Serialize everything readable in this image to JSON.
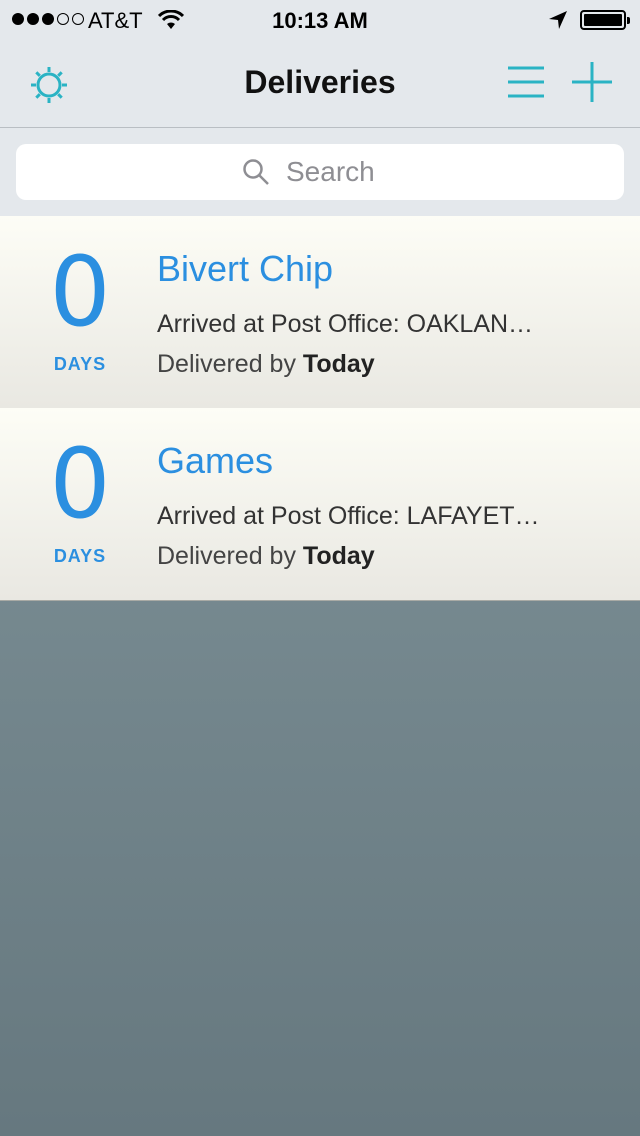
{
  "status_bar": {
    "carrier": "AT&T",
    "time": "10:13 AM",
    "signal_bars_filled": 3,
    "signal_bars_total": 5
  },
  "nav": {
    "title": "Deliveries",
    "settings_icon": "gear-icon",
    "list_icon": "menu-icon",
    "add_icon": "plus-icon"
  },
  "search": {
    "placeholder": "Search"
  },
  "deliveries": [
    {
      "days": "0",
      "days_label": "DAYS",
      "name": "Bivert Chip",
      "status": "Arrived at Post Office: OAKLAN…",
      "delivered_prefix": "Delivered by",
      "delivered_when": "Today"
    },
    {
      "days": "0",
      "days_label": "DAYS",
      "name": "Games",
      "status": "Arrived at Post Office: LAFAYET…",
      "delivered_prefix": "Delivered by",
      "delivered_when": "Today"
    }
  ],
  "colors": {
    "accent_teal": "#2ab3c4",
    "accent_blue": "#2b8fe0"
  }
}
